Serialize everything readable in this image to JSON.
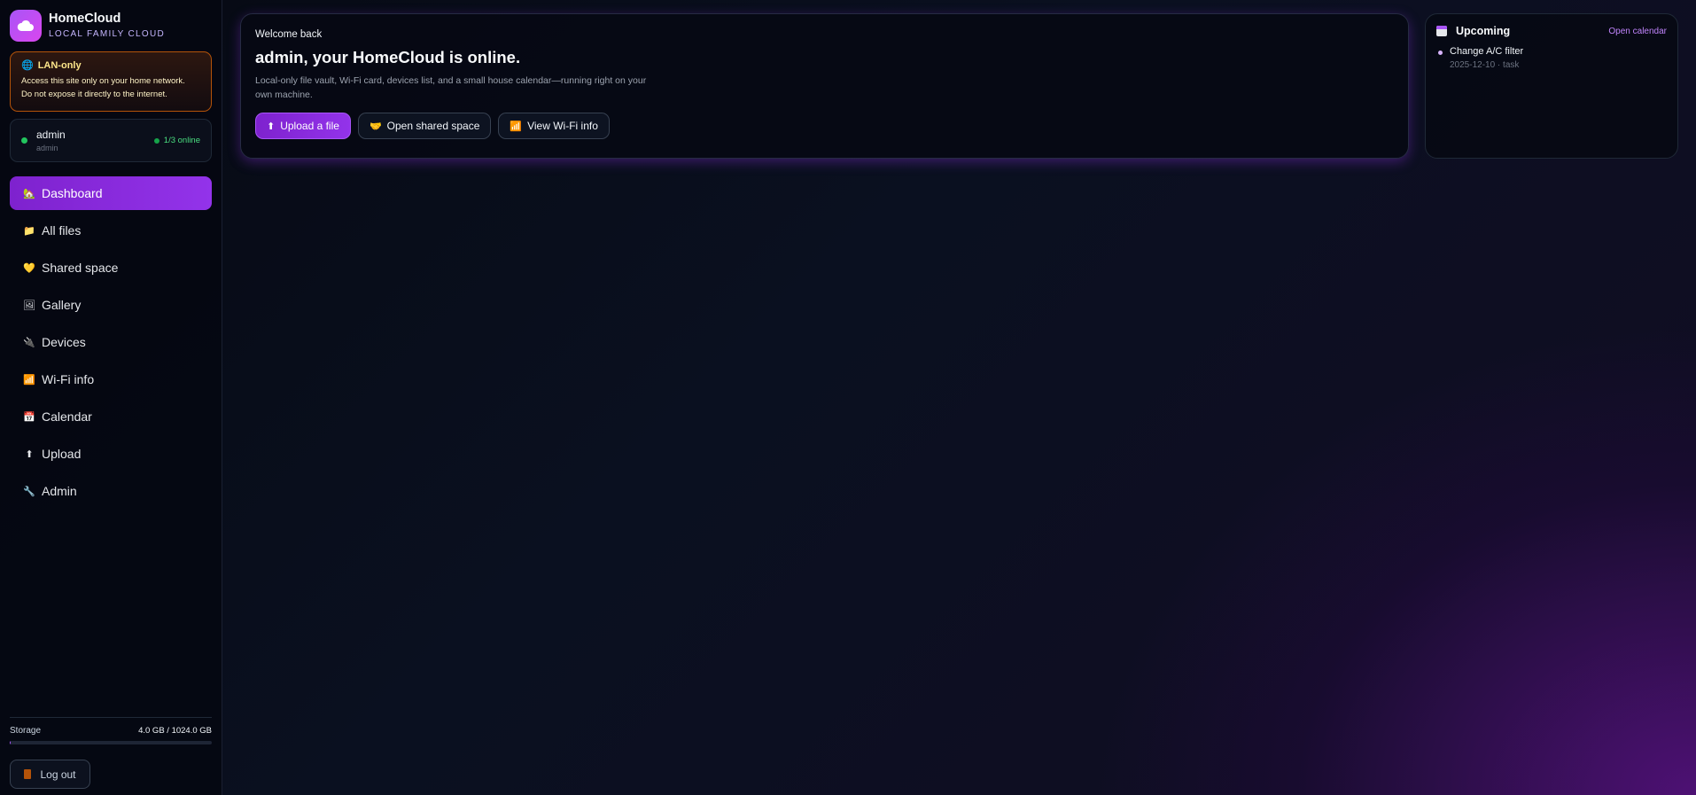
{
  "brand": {
    "name": "HomeCloud",
    "subtitle": "LOCAL FAMILY CLOUD",
    "logo_icon": "cloud-icon"
  },
  "lan_notice": {
    "icon": "globe-icon",
    "title": "LAN-only",
    "line1": "Access this site only on your home network.",
    "line2": "Do not expose it directly to the internet."
  },
  "user": {
    "name": "admin",
    "role": "admin",
    "online": "1/3 online"
  },
  "nav": {
    "items": [
      {
        "label": "Dashboard",
        "icon": "🏡",
        "active": true
      },
      {
        "label": "All files",
        "icon": "📁",
        "active": false
      },
      {
        "label": "Shared space",
        "icon": "💛",
        "active": false
      },
      {
        "label": "Gallery",
        "icon": "🖼",
        "active": false
      },
      {
        "label": "Devices",
        "icon": "🔌",
        "active": false
      },
      {
        "label": "Wi-Fi info",
        "icon": "📶",
        "active": false
      },
      {
        "label": "Calendar",
        "icon": "📅",
        "active": false
      },
      {
        "label": "Upload",
        "icon": "⬆",
        "active": false
      },
      {
        "label": "Admin",
        "icon": "🔧",
        "active": false
      }
    ]
  },
  "storage": {
    "label": "Storage",
    "value": "4.0 GB / 1024.0 GB",
    "fraction": 0.0039
  },
  "logout": {
    "label": "Log out"
  },
  "welcome": {
    "kicker": "Welcome back",
    "title": "admin, your HomeCloud is online.",
    "description": "Local-only file vault, Wi-Fi card, devices list, and a small house calendar—running right on your own machine.",
    "actions": [
      {
        "label": "Upload a file",
        "icon": "⬆",
        "primary": true
      },
      {
        "label": "Open shared space",
        "icon": "🤝",
        "primary": false
      },
      {
        "label": "View Wi-Fi info",
        "icon": "📶",
        "primary": false
      }
    ]
  },
  "upcoming": {
    "title": "Upcoming",
    "link": "Open calendar",
    "items": [
      {
        "name": "Change A/C filter",
        "meta": "2025-12-10 · task"
      }
    ]
  },
  "colors": {
    "accent": "#9333ea",
    "warning_border": "#b45309",
    "online": "#22c55e"
  }
}
